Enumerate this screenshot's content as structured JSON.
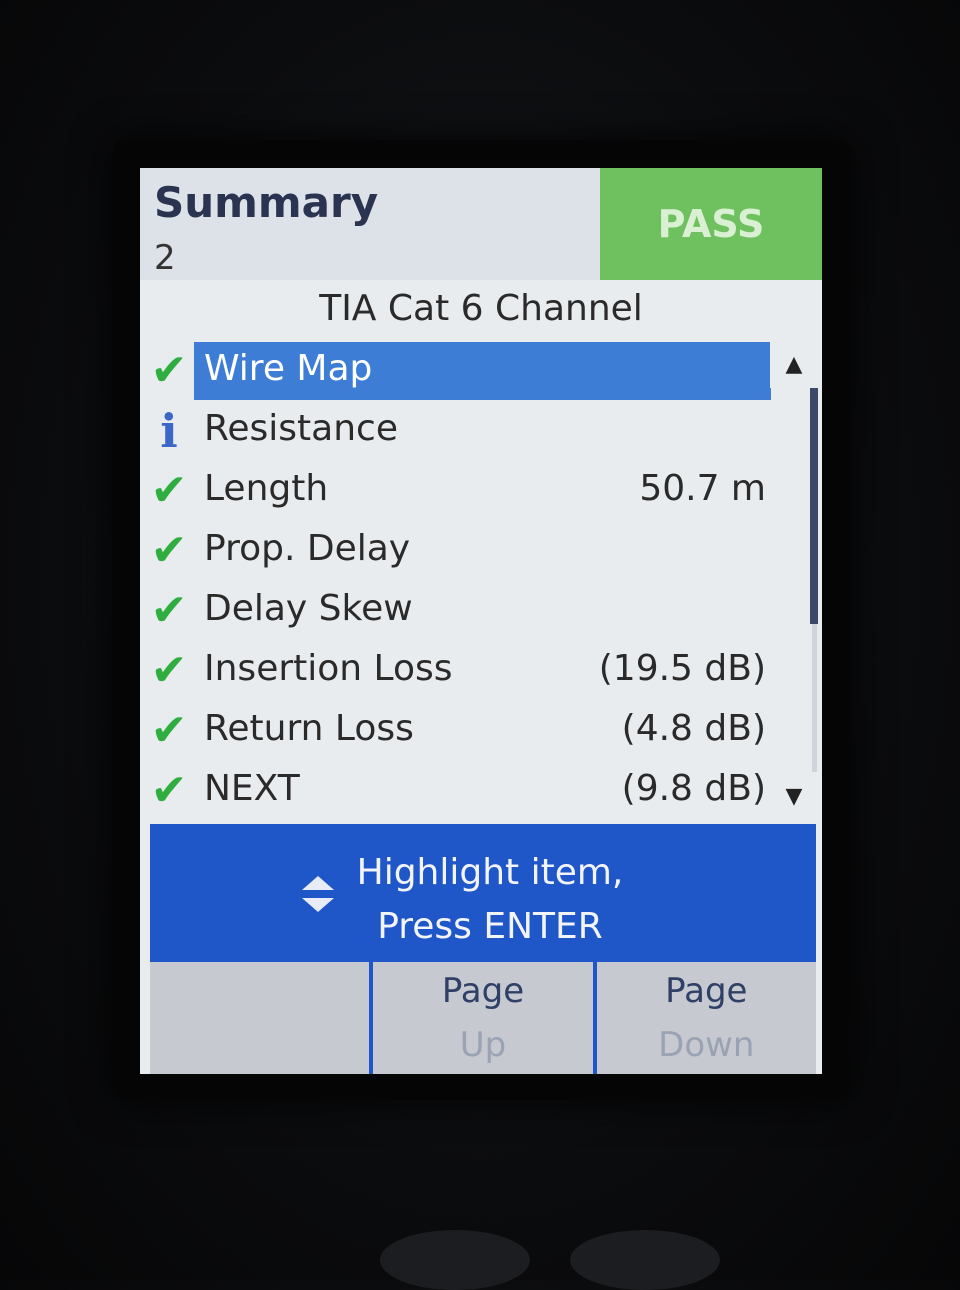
{
  "header": {
    "title": "Summary",
    "subtitle": "2",
    "status": "PASS",
    "status_color": "#6fc05e"
  },
  "standard": "TIA Cat 6 Channel",
  "results": [
    {
      "status": "check-icon",
      "label": "Wire Map",
      "value": "",
      "selected": true
    },
    {
      "status": "info-icon",
      "label": "Resistance",
      "value": ""
    },
    {
      "status": "check-icon",
      "label": "Length",
      "value": "50.7 m"
    },
    {
      "status": "check-icon",
      "label": "Prop. Delay",
      "value": ""
    },
    {
      "status": "check-icon",
      "label": "Delay Skew",
      "value": ""
    },
    {
      "status": "check-icon",
      "label": "Insertion Loss",
      "value": "(19.5 dB)"
    },
    {
      "status": "check-icon",
      "label": "Return Loss",
      "value": "(4.8 dB)"
    },
    {
      "status": "check-icon",
      "label": "NEXT",
      "value": "(9.8 dB)"
    }
  ],
  "hint": {
    "line1": "Highlight item,",
    "line2": "Press ENTER",
    "color": "#1f56c8"
  },
  "softkeys": [
    {
      "line1": "",
      "line2": ""
    },
    {
      "line1": "Page",
      "line2": "Up"
    },
    {
      "line1": "Page",
      "line2": "Down"
    }
  ],
  "colors": {
    "selection": "#3e7dd6",
    "check": "#2fae3f",
    "info": "#3a67c8"
  }
}
